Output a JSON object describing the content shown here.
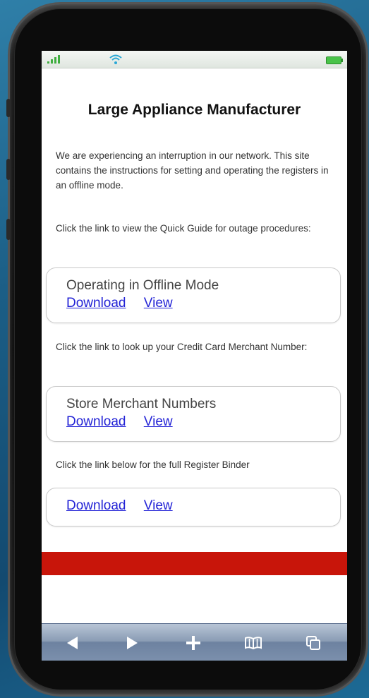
{
  "page": {
    "title": "Large Appliance Manufacturer",
    "intro": "We are experiencing an interruption in our network. This site contains the instructions for setting and operating the registers in an offline mode.",
    "quick_guide_prompt": "Click the link to view the Quick Guide for outage procedures:",
    "merchant_prompt": "Click the link to look up your Credit Card Merchant Number:",
    "binder_prompt": "Click the link below for the full Register Binder"
  },
  "cards": [
    {
      "title": "Operating in Offline Mode",
      "download_label": "Download",
      "view_label": "View"
    },
    {
      "title": "Store Merchant Numbers",
      "download_label": "Download",
      "view_label": "View"
    },
    {
      "title": "",
      "download_label": "Download",
      "view_label": "View"
    }
  ],
  "colors": {
    "accent_band": "#c8150a",
    "link": "#2323d6"
  },
  "status_bar": {
    "signal_icon": "signal-icon",
    "wifi_icon": "wifi-icon",
    "battery_icon": "battery-icon"
  },
  "toolbar": {
    "back_icon": "back-arrow-icon",
    "forward_icon": "forward-arrow-icon",
    "add_icon": "plus-icon",
    "bookmarks_icon": "book-icon",
    "tabs_icon": "tabs-icon"
  }
}
